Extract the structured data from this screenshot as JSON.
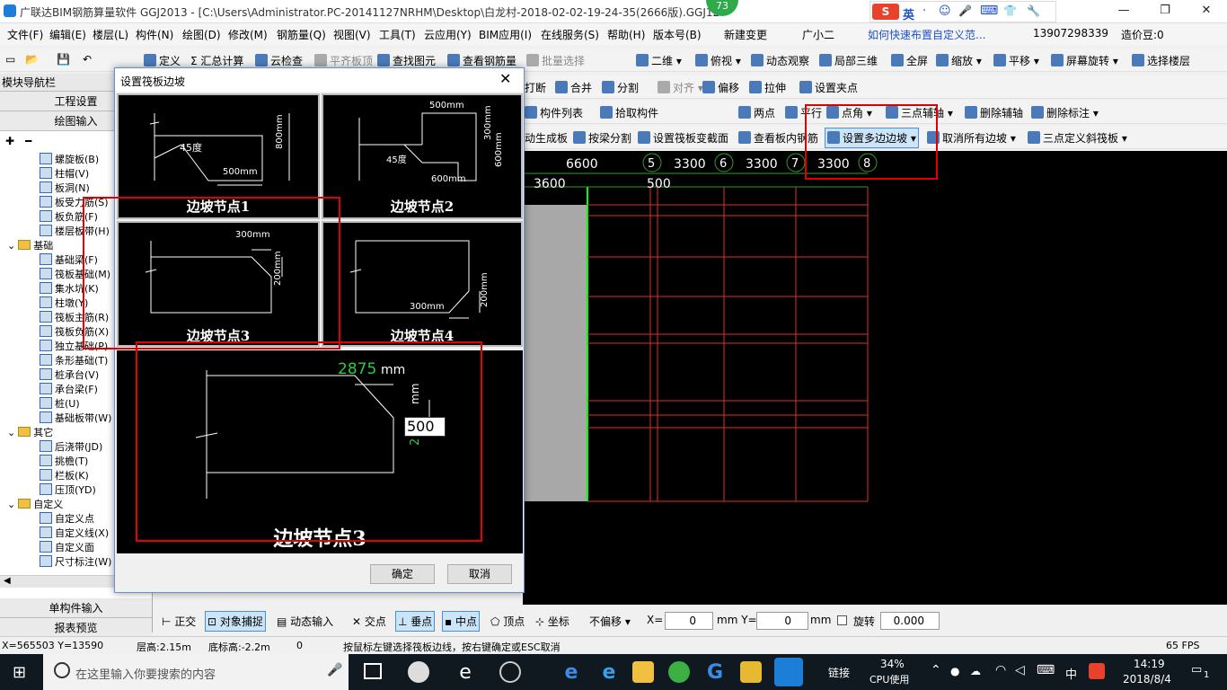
{
  "window": {
    "title": "广联达BIM钢筋算量软件 GGJ2013 - [C:\\Users\\Administrator.PC-20141127NRHM\\Desktop\\白龙村-2018-02-02-19-24-35(2666版).GGJ12",
    "badge": "73"
  },
  "ime": {
    "items": [
      "英",
      "·",
      "☺",
      "🎤",
      "⌨",
      "👕",
      "🔧"
    ]
  },
  "menu": [
    "文件(F)",
    "编辑(E)",
    "楼层(L)",
    "构件(N)",
    "绘图(D)",
    "修改(M)",
    "钢筋量(Q)",
    "视图(V)",
    "工具(T)",
    "云应用(Y)",
    "BIM应用(I)",
    "在线服务(S)",
    "帮助(H)",
    "版本号(B)",
    "新建变更",
    "广小二"
  ],
  "menu_right": {
    "promo": "如何快速布置自定义范...",
    "phone": "13907298339",
    "beans": "造价豆:0"
  },
  "toolbar1": [
    "定义",
    "汇总计算",
    "云检查",
    "平齐板顶",
    "查找图元",
    "查看钢筋量",
    "批量选择",
    "二维",
    "俯视",
    "动态观察",
    "局部三维",
    "全屏",
    "缩放",
    "平移",
    "屏幕旋转",
    "选择楼层"
  ],
  "toolbar2": [
    "打断",
    "合并",
    "分割",
    "对齐",
    "偏移",
    "拉伸",
    "设置夹点"
  ],
  "toolbar3": [
    "构件列表",
    "拾取构件",
    "两点",
    "平行",
    "点角",
    "三点辅轴",
    "删除辅轴",
    "删除标注"
  ],
  "toolbar4": [
    "动生成板",
    "按梁分割",
    "设置筏板变截面",
    "查看板内钢筋",
    "设置多边边坡",
    "取消所有边坡",
    "三点定义斜筏板"
  ],
  "sidebar": {
    "title": "模块导航栏",
    "buttons": [
      "工程设置",
      "绘图输入"
    ],
    "tree": [
      {
        "label": "螺旋板(B)",
        "type": "leaf"
      },
      {
        "label": "柱帽(V)",
        "type": "leaf"
      },
      {
        "label": "板洞(N)",
        "type": "leaf"
      },
      {
        "label": "板受力筋(S)",
        "type": "leaf"
      },
      {
        "label": "板负筋(F)",
        "type": "leaf"
      },
      {
        "label": "楼层板带(H)",
        "type": "leaf"
      },
      {
        "label": "基础",
        "type": "folder"
      },
      {
        "label": "基础梁(F)",
        "type": "leaf"
      },
      {
        "label": "筏板基础(M)",
        "type": "leaf"
      },
      {
        "label": "集水坑(K)",
        "type": "leaf"
      },
      {
        "label": "柱墩(Y)",
        "type": "leaf"
      },
      {
        "label": "筏板主筋(R)",
        "type": "leaf"
      },
      {
        "label": "筏板负筋(X)",
        "type": "leaf"
      },
      {
        "label": "独立基础(P)",
        "type": "leaf"
      },
      {
        "label": "条形基础(T)",
        "type": "leaf"
      },
      {
        "label": "桩承台(V)",
        "type": "leaf"
      },
      {
        "label": "承台梁(F)",
        "type": "leaf"
      },
      {
        "label": "桩(U)",
        "type": "leaf"
      },
      {
        "label": "基础板带(W)",
        "type": "leaf"
      },
      {
        "label": "其它",
        "type": "folder"
      },
      {
        "label": "后浇带(JD)",
        "type": "leaf"
      },
      {
        "label": "挑檐(T)",
        "type": "leaf"
      },
      {
        "label": "栏板(K)",
        "type": "leaf"
      },
      {
        "label": "压顶(YD)",
        "type": "leaf"
      },
      {
        "label": "自定义",
        "type": "folder"
      },
      {
        "label": "自定义点",
        "type": "leaf"
      },
      {
        "label": "自定义线(X)",
        "type": "leaf"
      },
      {
        "label": "自定义面",
        "type": "leaf"
      },
      {
        "label": "尺寸标注(W)",
        "type": "leaf"
      }
    ],
    "bottom_buttons": [
      "单构件输入",
      "报表预览"
    ]
  },
  "dialog": {
    "title": "设置筏板边坡",
    "panels": [
      {
        "label": "边坡节点1",
        "dims": [
          "45度",
          "500mm",
          "800mm"
        ]
      },
      {
        "label": "边坡节点2",
        "dims": [
          "500mm",
          "300mm",
          "600mm",
          "45度",
          "600mm"
        ]
      },
      {
        "label": "边坡节点3",
        "dims": [
          "300mm",
          "200mm"
        ]
      },
      {
        "label": "边坡节点4",
        "dims": [
          "300mm",
          "200mm"
        ]
      }
    ],
    "preview": {
      "label": "边坡节点3",
      "width_value": "2875",
      "width_unit": "mm",
      "height_value": "500",
      "height_unit": "mm",
      "height_partial": "2"
    },
    "ok": "确定",
    "cancel": "取消"
  },
  "canvas": {
    "top_dims": [
      "6600",
      "3300",
      "3300",
      "3300"
    ],
    "axis_labels": [
      "5",
      "6",
      "7",
      "8"
    ],
    "sub_dims": [
      "3600",
      "500"
    ]
  },
  "snapbar": {
    "items": [
      "正交",
      "对象捕捉",
      "动态输入",
      "交点",
      "垂点",
      "中点",
      "顶点",
      "坐标"
    ],
    "offset": "不偏移",
    "x_label": "X=",
    "x_value": "0",
    "y_label": "mm Y=",
    "y_value": "0",
    "unit": "mm",
    "rotate_label": "旋转",
    "rotate_value": "0.000"
  },
  "status": {
    "coords": "X=565503 Y=13590",
    "floor_h": "层高:2.15m",
    "base_h": "底标高:-2.2m",
    "zero": "0",
    "hint": "按鼠标左键选择筏板边线，按右键确定或ESC取消",
    "fps": "65 FPS"
  },
  "taskbar": {
    "search": "在这里输入你要搜索的内容",
    "link": "链接",
    "cpu_pct": "34%",
    "cpu_label": "CPU使用",
    "lang": "中",
    "time": "14:19",
    "date": "2018/8/4",
    "notif": "1"
  }
}
